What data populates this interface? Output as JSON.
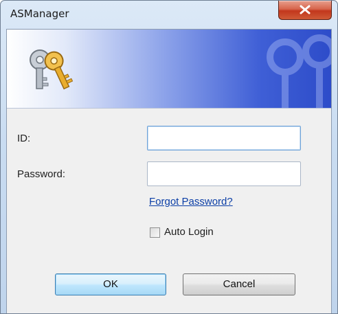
{
  "window": {
    "title": "ASManager"
  },
  "form": {
    "id_label": "ID:",
    "id_value": "",
    "password_label": "Password:",
    "password_value": "",
    "forgot_link": "Forgot Password?",
    "auto_login_label": "Auto Login",
    "auto_login_checked": false
  },
  "buttons": {
    "ok": "OK",
    "cancel": "Cancel"
  },
  "icons": {
    "close": "close-icon",
    "banner": "keys-icon"
  },
  "colors": {
    "link": "#0b3ea6",
    "close_button": "#c2371d",
    "banner_dark": "#2d4cc9"
  }
}
